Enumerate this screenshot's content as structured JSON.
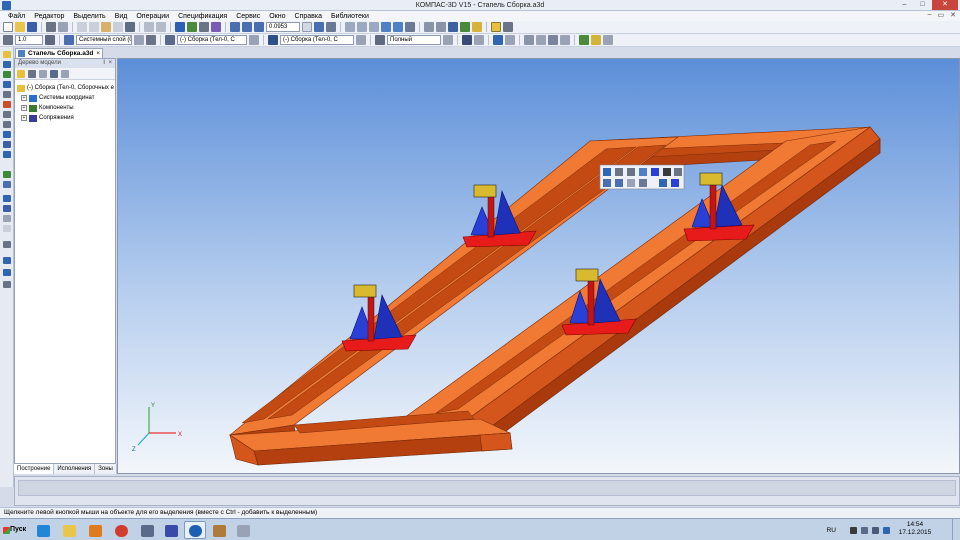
{
  "window": {
    "title": "КОМПАС-3D V15 - Стапель Сборка.a3d",
    "controls": [
      "–",
      "□",
      "✕"
    ]
  },
  "menu": {
    "items": [
      "Файл",
      "Редактор",
      "Выделить",
      "Вид",
      "Операции",
      "Спецификация",
      "Сервис",
      "Окно",
      "Справка",
      "Библиотеки"
    ],
    "doc_controls": [
      "–",
      "▭",
      "✕"
    ]
  },
  "toolbar": {
    "zoom_value": "0.0953",
    "step_value": "1.0",
    "layer_value": "Системный слой (0)",
    "assembly_value": "(-) Сборка (Тел-0, С",
    "assembly_value_2": "(-) Сборка (Тел-0, С",
    "view_mode": "Полный"
  },
  "doc_tab": {
    "label": "Стапель Сборка.a3d",
    "close": "×"
  },
  "tree": {
    "title": "Дерево модели",
    "pin": "ⵏ",
    "close": "×",
    "root": "(-) Сборка (Тел-0, Сборочных е",
    "items": [
      {
        "expander": "+",
        "label": "Системы координат",
        "color": "#2a6fc9"
      },
      {
        "expander": "+",
        "label": "Компоненты",
        "color": "#3c7a2e"
      },
      {
        "expander": "+",
        "label": "Сопряжения",
        "color": "#3a3a9f"
      }
    ],
    "tabs": [
      "Построение",
      "Исполнения",
      "Зоны"
    ]
  },
  "status": {
    "hint": "Щелкните левой кнопкой мыши на объекте для его выделения (вместе с Ctrl - добавить к выделенным)"
  },
  "axes": {
    "x": "X",
    "y": "Y",
    "z": "Z"
  },
  "taskbar": {
    "start_label": "Пуск",
    "lang": "RU",
    "time": "14:54",
    "date": "17.12.2015"
  },
  "colors": {
    "beam": "#e8631f",
    "beam_dark": "#b4400f",
    "beam_light": "#f07a34",
    "support_blue": "#2a3fd6",
    "support_red": "#e81b1b",
    "bg_top": "#5c8fd9",
    "bg_bottom": "#f4f7fb"
  }
}
